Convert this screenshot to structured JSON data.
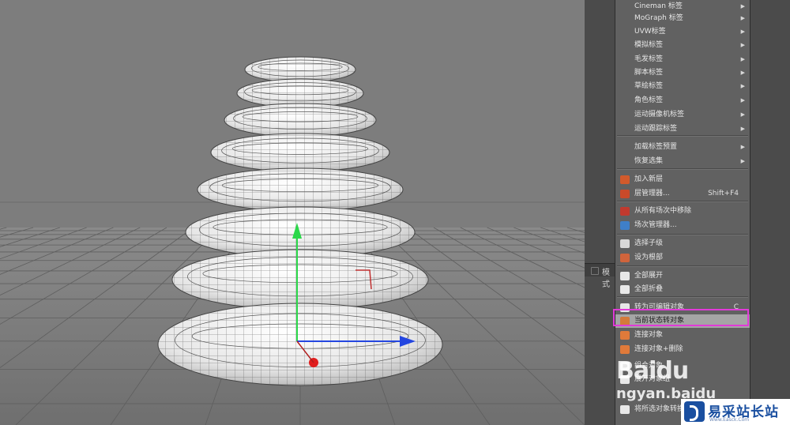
{
  "context_menu": {
    "items": [
      {
        "label": "Cineman 标签",
        "submenu": true
      },
      {
        "label": "MoGraph 标签",
        "submenu": true
      },
      {
        "label": "UVW标签",
        "submenu": true
      },
      {
        "label": "模拟标签",
        "submenu": true
      },
      {
        "label": "毛发标签",
        "submenu": true
      },
      {
        "label": "脚本标签",
        "submenu": true
      },
      {
        "label": "草绘标签",
        "submenu": true
      },
      {
        "label": "角色标签",
        "submenu": true
      },
      {
        "label": "运动摄像机标签",
        "submenu": true
      },
      {
        "label": "运动跟踪标签",
        "submenu": true
      },
      {
        "label": "加载标签预置",
        "submenu": true
      },
      {
        "label": "恢复选集",
        "submenu": true
      },
      {
        "label": "加入新层",
        "icon": "layer-add-icon",
        "icon_color": "#d25a2c"
      },
      {
        "label": "层管理器...",
        "shortcut": "Shift+F4",
        "icon": "layer-manager-icon",
        "icon_color": "#c94a2a"
      },
      {
        "label": "从所有场次中移除",
        "icon": "take-remove-icon",
        "icon_color": "#c13a2e"
      },
      {
        "label": "场次管理器...",
        "icon": "take-manager-icon",
        "icon_color": "#3f7fc8"
      },
      {
        "label": "选择子级",
        "icon": "select-children-icon",
        "icon_color": "#d9d9d9"
      },
      {
        "label": "设为根部",
        "icon": "set-root-icon",
        "icon_color": "#d0643c"
      },
      {
        "label": "全部展开",
        "icon": "expand-all-icon",
        "icon_color": "#e8e8e8"
      },
      {
        "label": "全部折叠",
        "icon": "collapse-all-icon",
        "icon_color": "#e8e8e8"
      },
      {
        "label": "转为可编辑对象",
        "shortcut": "C",
        "icon": "make-editable-icon",
        "icon_color": "#e6e6e6"
      },
      {
        "label": "当前状态转对象",
        "icon": "current-state-to-object-icon",
        "icon_color": "#d47a3a",
        "highlighted": true
      },
      {
        "label": "连接对象",
        "icon": "connect-objects-icon",
        "icon_color": "#e07a3a"
      },
      {
        "label": "连接对象+删除",
        "icon": "connect-delete-icon",
        "icon_color": "#e07a3a"
      },
      {
        "label": "组合对象",
        "icon": "group-objects-icon",
        "icon_color": "#e8e8e8"
      },
      {
        "label": "展开对象组",
        "icon": "expand-group-icon",
        "icon_color": "#e8e8e8"
      },
      {
        "label": "将所选对象转换",
        "icon": "convert-selection-icon",
        "icon_color": "#e8e8e8"
      }
    ]
  },
  "attribute_panel": {
    "tab_label": "模式"
  },
  "watermark": {
    "text": "Baidu",
    "sub": "ngyan.baidu"
  },
  "site_logo": {
    "name": "易采站长站",
    "url": "Www.Easck.Com"
  },
  "colors": {
    "viewport": "#7d7d7d",
    "menu": "#616161",
    "highlight_border": "#e13ad8",
    "highlight_fill": "#a5a5a5"
  }
}
